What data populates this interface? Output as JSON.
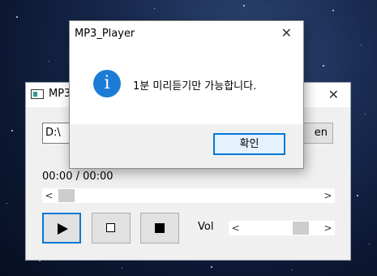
{
  "main_window": {
    "title": "MP3",
    "close_glyph": "✕",
    "path_value": "D:\\",
    "open_label": "en",
    "time": "00:00 / 00:00",
    "seek": {
      "left_arrow": "<",
      "right_arrow": ">"
    },
    "controls": {
      "play_icon": "play-icon",
      "pause_icon": "pause-icon",
      "stop_icon": "stop-icon"
    },
    "volume": {
      "label": "Vol",
      "left_arrow": "<",
      "right_arrow": ">",
      "level": 0.8
    }
  },
  "dialog": {
    "title": "MP3_Player",
    "close_glyph": "✕",
    "icon": "i",
    "message": "1분 미리듣기만 가능합니다.",
    "ok_label": "확인",
    "accent": "#0078d7",
    "icon_color": "#1c7cd5"
  }
}
